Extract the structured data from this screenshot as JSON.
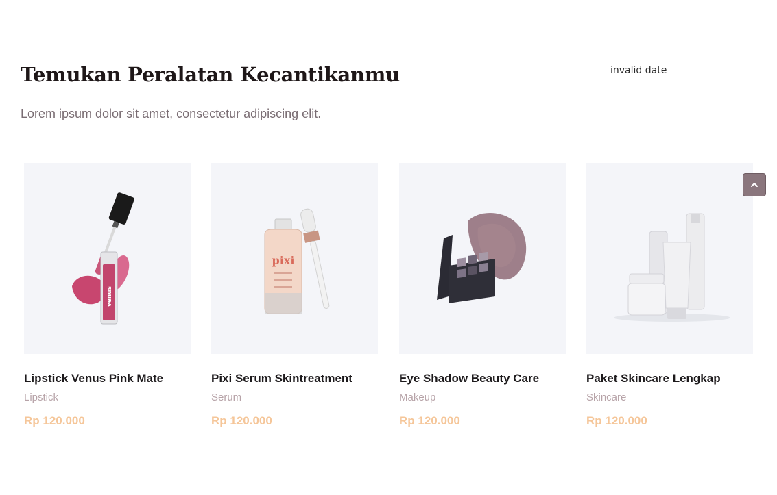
{
  "header": {
    "title": "Temukan Peralatan Kecantikanmu",
    "subtitle": "Lorem ipsum dolor sit amet, consectetur adipiscing elit.",
    "date_text": "invalid date"
  },
  "products": [
    {
      "name": "Lipstick Venus Pink Mate",
      "category": "Lipstick",
      "price": "Rp 120.000",
      "image": "lipgloss-image",
      "brand_text": "venus"
    },
    {
      "name": "Pixi Serum Skintreatment",
      "category": "Serum",
      "price": "Rp 120.000",
      "image": "serum-bottle-image",
      "brand_text": "pixi"
    },
    {
      "name": "Eye Shadow Beauty Care",
      "category": "Makeup",
      "price": "Rp 120.000",
      "image": "eyeshadow-palette-image"
    },
    {
      "name": "Paket Skincare Lengkap",
      "category": "Skincare",
      "price": "Rp 120.000",
      "image": "skincare-set-image"
    }
  ],
  "scroll_top": {
    "icon": "chevron-up-icon"
  },
  "colors": {
    "accent_price": "#f5c699",
    "category_text": "#b7a3a8",
    "image_bg": "#f4f5f9",
    "scroll_button": "#8a767d"
  }
}
